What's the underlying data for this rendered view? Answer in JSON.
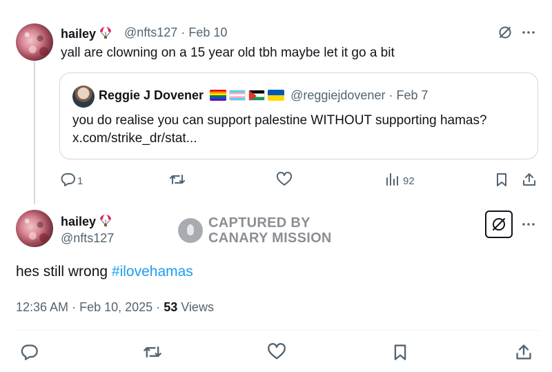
{
  "reply_tweet": {
    "display_name": "hailey",
    "handle": "@nfts127",
    "separator": "·",
    "date": "Feb 10",
    "text": "yall are clowning on a 15 year old tbh maybe let it go a bit",
    "reply_count": "1",
    "views": "92"
  },
  "quoted_tweet": {
    "display_name": "Reggie J Dovener",
    "handle": "@reggiejdovener",
    "separator": "·",
    "date": "Feb 7",
    "text": "you do realise you can support palestine WITHOUT supporting hamas?",
    "link": "x.com/strike_dr/stat..."
  },
  "main_tweet": {
    "display_name": "hailey",
    "handle": "@nfts127",
    "text_prefix": "hes still wrong ",
    "hashtag": "#ilovehamas",
    "time": "12:36 AM",
    "separator": "·",
    "date": "Feb 10, 2025",
    "views_count": "53",
    "views_label": " Views"
  },
  "watermark": {
    "line1": "CAPTURED BY",
    "line2": "CANARY MISSION"
  },
  "icons": {
    "more": "more-icon",
    "grok": "grok-icon",
    "reply": "reply-icon",
    "retweet": "retweet-icon",
    "like": "like-icon",
    "views": "views-icon",
    "bookmark": "bookmark-icon",
    "share": "share-icon"
  },
  "colors": {
    "text": "#0f1419",
    "muted": "#536471",
    "link": "#1d9bf0",
    "border": "#cfd9de"
  }
}
